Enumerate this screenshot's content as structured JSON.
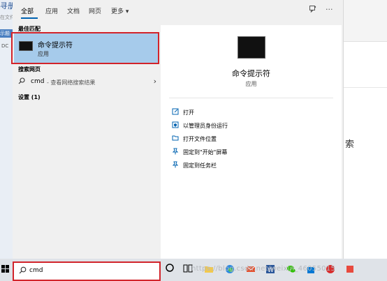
{
  "background": {
    "left_title": "寻册",
    "left_placeholder": "在文件",
    "left_tab": "示题",
    "left_item": "DC",
    "right_char": "索"
  },
  "tabs": [
    {
      "label": "全部",
      "active": true
    },
    {
      "label": "应用",
      "active": false
    },
    {
      "label": "文档",
      "active": false
    },
    {
      "label": "网页",
      "active": false
    },
    {
      "label": "更多 ▾",
      "active": false
    }
  ],
  "header_icons": {
    "feedback": "feedback-icon",
    "more": "···"
  },
  "best_match": {
    "section_title": "最佳匹配",
    "name": "命令提示符",
    "type": "应用"
  },
  "web": {
    "section_title": "搜索网页",
    "query": "cmd",
    "description": "- 查看网络搜索结果"
  },
  "settings": {
    "section_title": "设置 (1)"
  },
  "preview": {
    "name": "命令提示符",
    "type": "应用",
    "actions": [
      {
        "icon": "open-icon",
        "label": "打开"
      },
      {
        "icon": "admin-icon",
        "label": "以管理员身份运行"
      },
      {
        "icon": "folder-icon",
        "label": "打开文件位置"
      },
      {
        "icon": "pin-start-icon",
        "label": "固定到\"开始\"屏幕"
      },
      {
        "icon": "pin-taskbar-icon",
        "label": "固定到任务栏"
      }
    ]
  },
  "search": {
    "value": "cmd"
  },
  "taskbar": {
    "watermark": "https://blog.csdn.net/weixin_46055015",
    "accent": "#0063b1",
    "highlight_red": "#d2232a"
  }
}
